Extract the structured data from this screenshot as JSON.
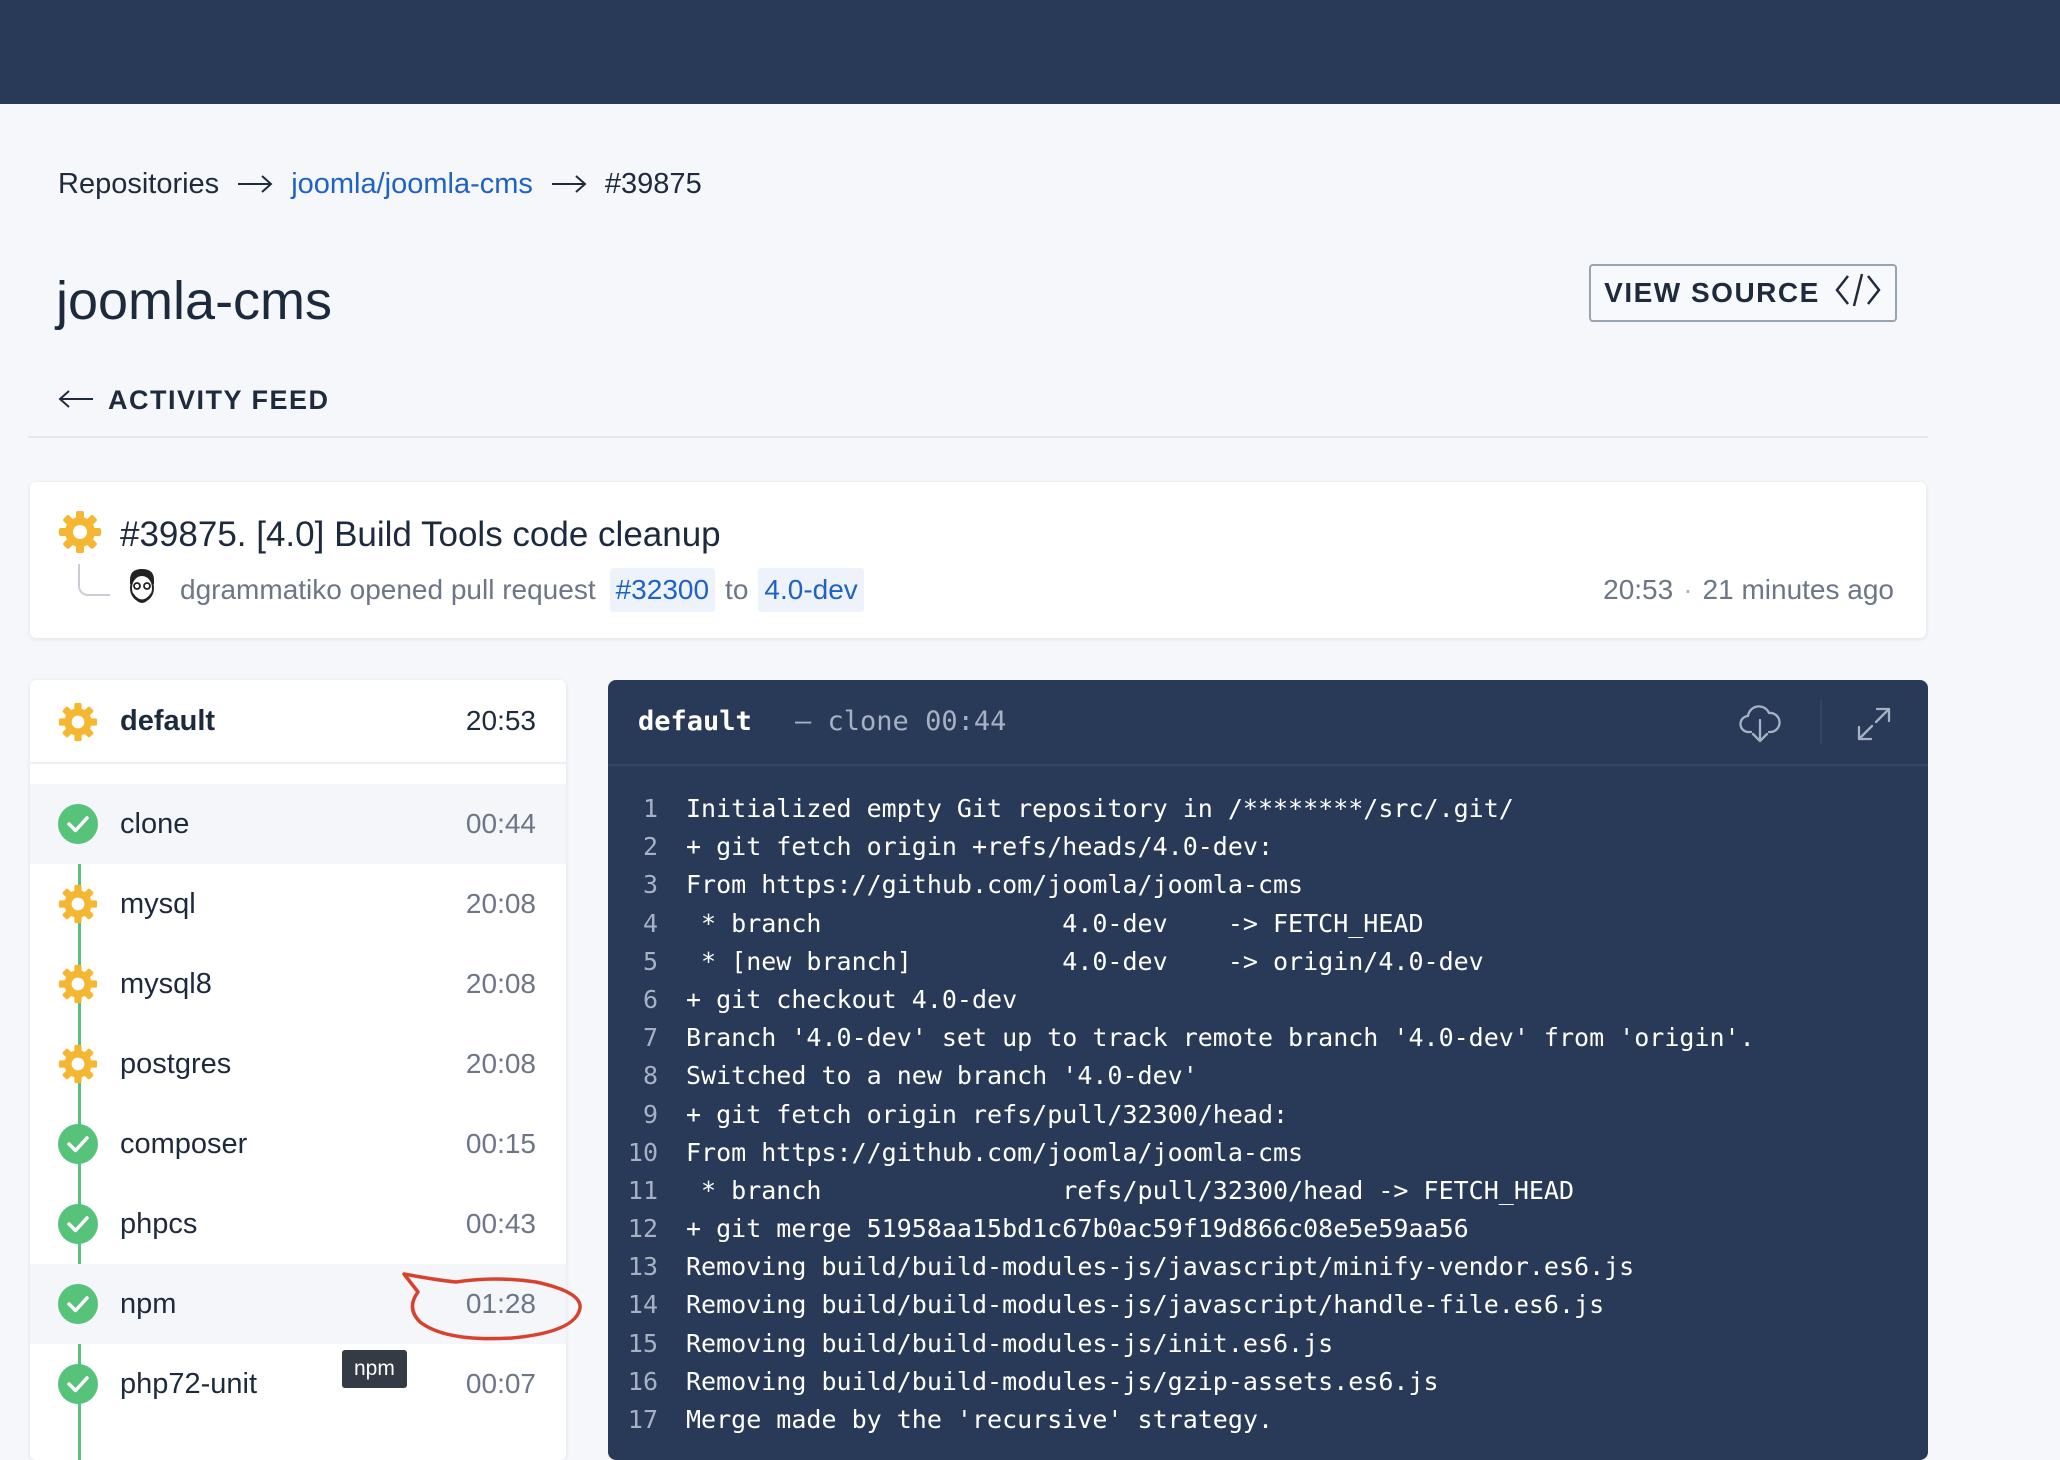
{
  "breadcrumb": {
    "items": [
      "Repositories",
      "joomla/joomla-cms",
      "#39875"
    ]
  },
  "page": {
    "title": "joomla-cms",
    "view_source_label": "VIEW SOURCE",
    "activity_feed_label": "ACTIVITY FEED"
  },
  "build": {
    "title": "#39875. [4.0] Build Tools code cleanup",
    "author": "dgrammatiko",
    "action": "opened pull request",
    "pr": "#32300",
    "to_word": "to",
    "branch": "4.0-dev",
    "time": "20:53",
    "separator": "·",
    "ago": "21 minutes ago",
    "status_color": "#f5b731"
  },
  "stage": {
    "name": "default",
    "time": "20:53"
  },
  "steps": [
    {
      "label": "clone",
      "duration": "00:44",
      "status": "success",
      "active": true
    },
    {
      "label": "mysql",
      "duration": "20:08",
      "status": "running"
    },
    {
      "label": "mysql8",
      "duration": "20:08",
      "status": "running"
    },
    {
      "label": "postgres",
      "duration": "20:08",
      "status": "running"
    },
    {
      "label": "composer",
      "duration": "00:15",
      "status": "success"
    },
    {
      "label": "phpcs",
      "duration": "00:43",
      "status": "success"
    },
    {
      "label": "npm",
      "duration": "01:28",
      "status": "success",
      "hover": true
    },
    {
      "label": "php72-unit",
      "duration": "00:07",
      "status": "success"
    }
  ],
  "tooltip": "npm",
  "log": {
    "stage": "default",
    "dash": "—",
    "step": "clone",
    "duration": "00:44",
    "lines": [
      "Initialized empty Git repository in /********/src/.git/",
      "+ git fetch origin +refs/heads/4.0-dev:",
      "From https://github.com/joomla/joomla-cms",
      " * branch                4.0-dev    -> FETCH_HEAD",
      " * [new branch]          4.0-dev    -> origin/4.0-dev",
      "+ git checkout 4.0-dev",
      "Branch '4.0-dev' set up to track remote branch '4.0-dev' from 'origin'.",
      "Switched to a new branch '4.0-dev'",
      "+ git fetch origin refs/pull/32300/head:",
      "From https://github.com/joomla/joomla-cms",
      " * branch                refs/pull/32300/head -> FETCH_HEAD",
      "+ git merge 51958aa15bd1c67b0ac59f19d866c08e5e59aa56",
      "Removing build/build-modules-js/javascript/minify-vendor.es6.js",
      "Removing build/build-modules-js/javascript/handle-file.es6.js",
      "Removing build/build-modules-js/init.es6.js",
      "Removing build/build-modules-js/gzip-assets.es6.js",
      "Merge made by the 'recursive' strategy."
    ]
  },
  "icons": {
    "running": "gear-icon",
    "success": "check-circle-icon",
    "download": "cloud-download-icon",
    "expand": "expand-icon",
    "code": "code-icon",
    "back": "arrow-left-icon"
  },
  "colors": {
    "topbar": "#293a59",
    "link": "#1f62c5",
    "success": "#56c27a",
    "running": "#f5b731",
    "annotation": "#d9412f"
  }
}
